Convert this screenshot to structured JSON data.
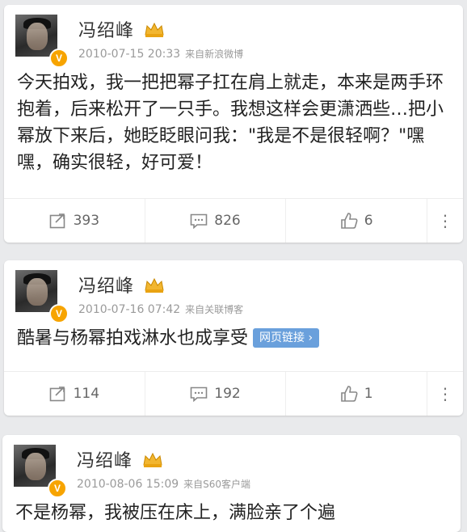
{
  "posts": [
    {
      "username": "冯绍峰",
      "timestamp": "2010-07-15 20:33",
      "source": "来自新浪微博",
      "text": "今天拍戏，我一把把幂子扛在肩上就走，本来是两手环抱着，后来松开了一只手。我想这样会更潇洒些…把小幂放下来后，她眨眨眼问我：\"我是不是很轻啊？\"嘿嘿，确实很轻，好可爱！",
      "reposts": "393",
      "comments": "826",
      "likes": "6",
      "link_chip": ""
    },
    {
      "username": "冯绍峰",
      "timestamp": "2010-07-16 07:42",
      "source": "来自关联博客",
      "text": "酷暑与杨幂拍戏淋水也成享受",
      "reposts": "114",
      "comments": "192",
      "likes": "1",
      "link_chip": "网页链接 ›"
    },
    {
      "username": "冯绍峰",
      "timestamp": "2010-08-06 15:09",
      "source": "来自S60客户端",
      "text": "不是杨幂，我被压在床上，满脸亲了个遍",
      "reposts": "",
      "comments": "",
      "likes": "",
      "link_chip": ""
    }
  ],
  "colors": {
    "background": "#e9eaec",
    "card": "#ffffff",
    "verified_badge": "#f7a400",
    "link_chip": "#6aa0dc"
  },
  "icons": {
    "verified": "V",
    "repost": "repost-icon",
    "comment": "comment-icon",
    "like": "thumbs-up-icon",
    "more": "⋮"
  }
}
